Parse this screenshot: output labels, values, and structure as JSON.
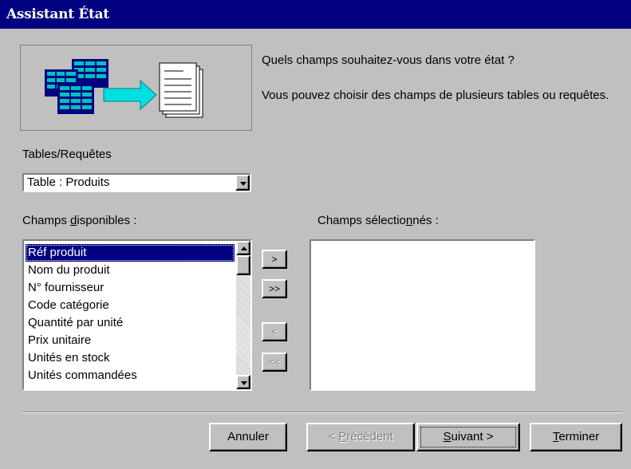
{
  "window": {
    "title": "Assistant État"
  },
  "intro": {
    "question": "Quels champs souhaitez-vous dans votre état ?",
    "hint": "Vous pouvez choisir des champs de plusieurs tables ou requêtes."
  },
  "source": {
    "label": "Tables/Requêtes",
    "selected": "Table : Produits"
  },
  "available": {
    "label_pre": "Champs ",
    "label_accel": "d",
    "label_post": "isponibles :",
    "items": [
      "Réf produit",
      "Nom du produit",
      "N° fournisseur",
      "Code catégorie",
      "Quantité par unité",
      "Prix unitaire",
      "Unités en stock",
      "Unités commandées"
    ],
    "selected_index": 0
  },
  "selected_fields": {
    "label_pre": "Champs sélectio",
    "label_accel": "n",
    "label_post": "nés :",
    "items": []
  },
  "move_buttons": {
    "add_one": ">",
    "add_all": ">>",
    "remove_one": "<",
    "remove_all": "<<"
  },
  "buttons": {
    "cancel": "Annuler",
    "back_pre": "< ",
    "back_accel": "P",
    "back_post": "récédent",
    "next_accel": "S",
    "next_post": "uivant >",
    "finish_accel": "T",
    "finish_post": "erminer"
  },
  "colors": {
    "titlebar": "#000080",
    "face": "#c0c0c0",
    "selection": "#000080",
    "arrow": "#00e0e0"
  }
}
